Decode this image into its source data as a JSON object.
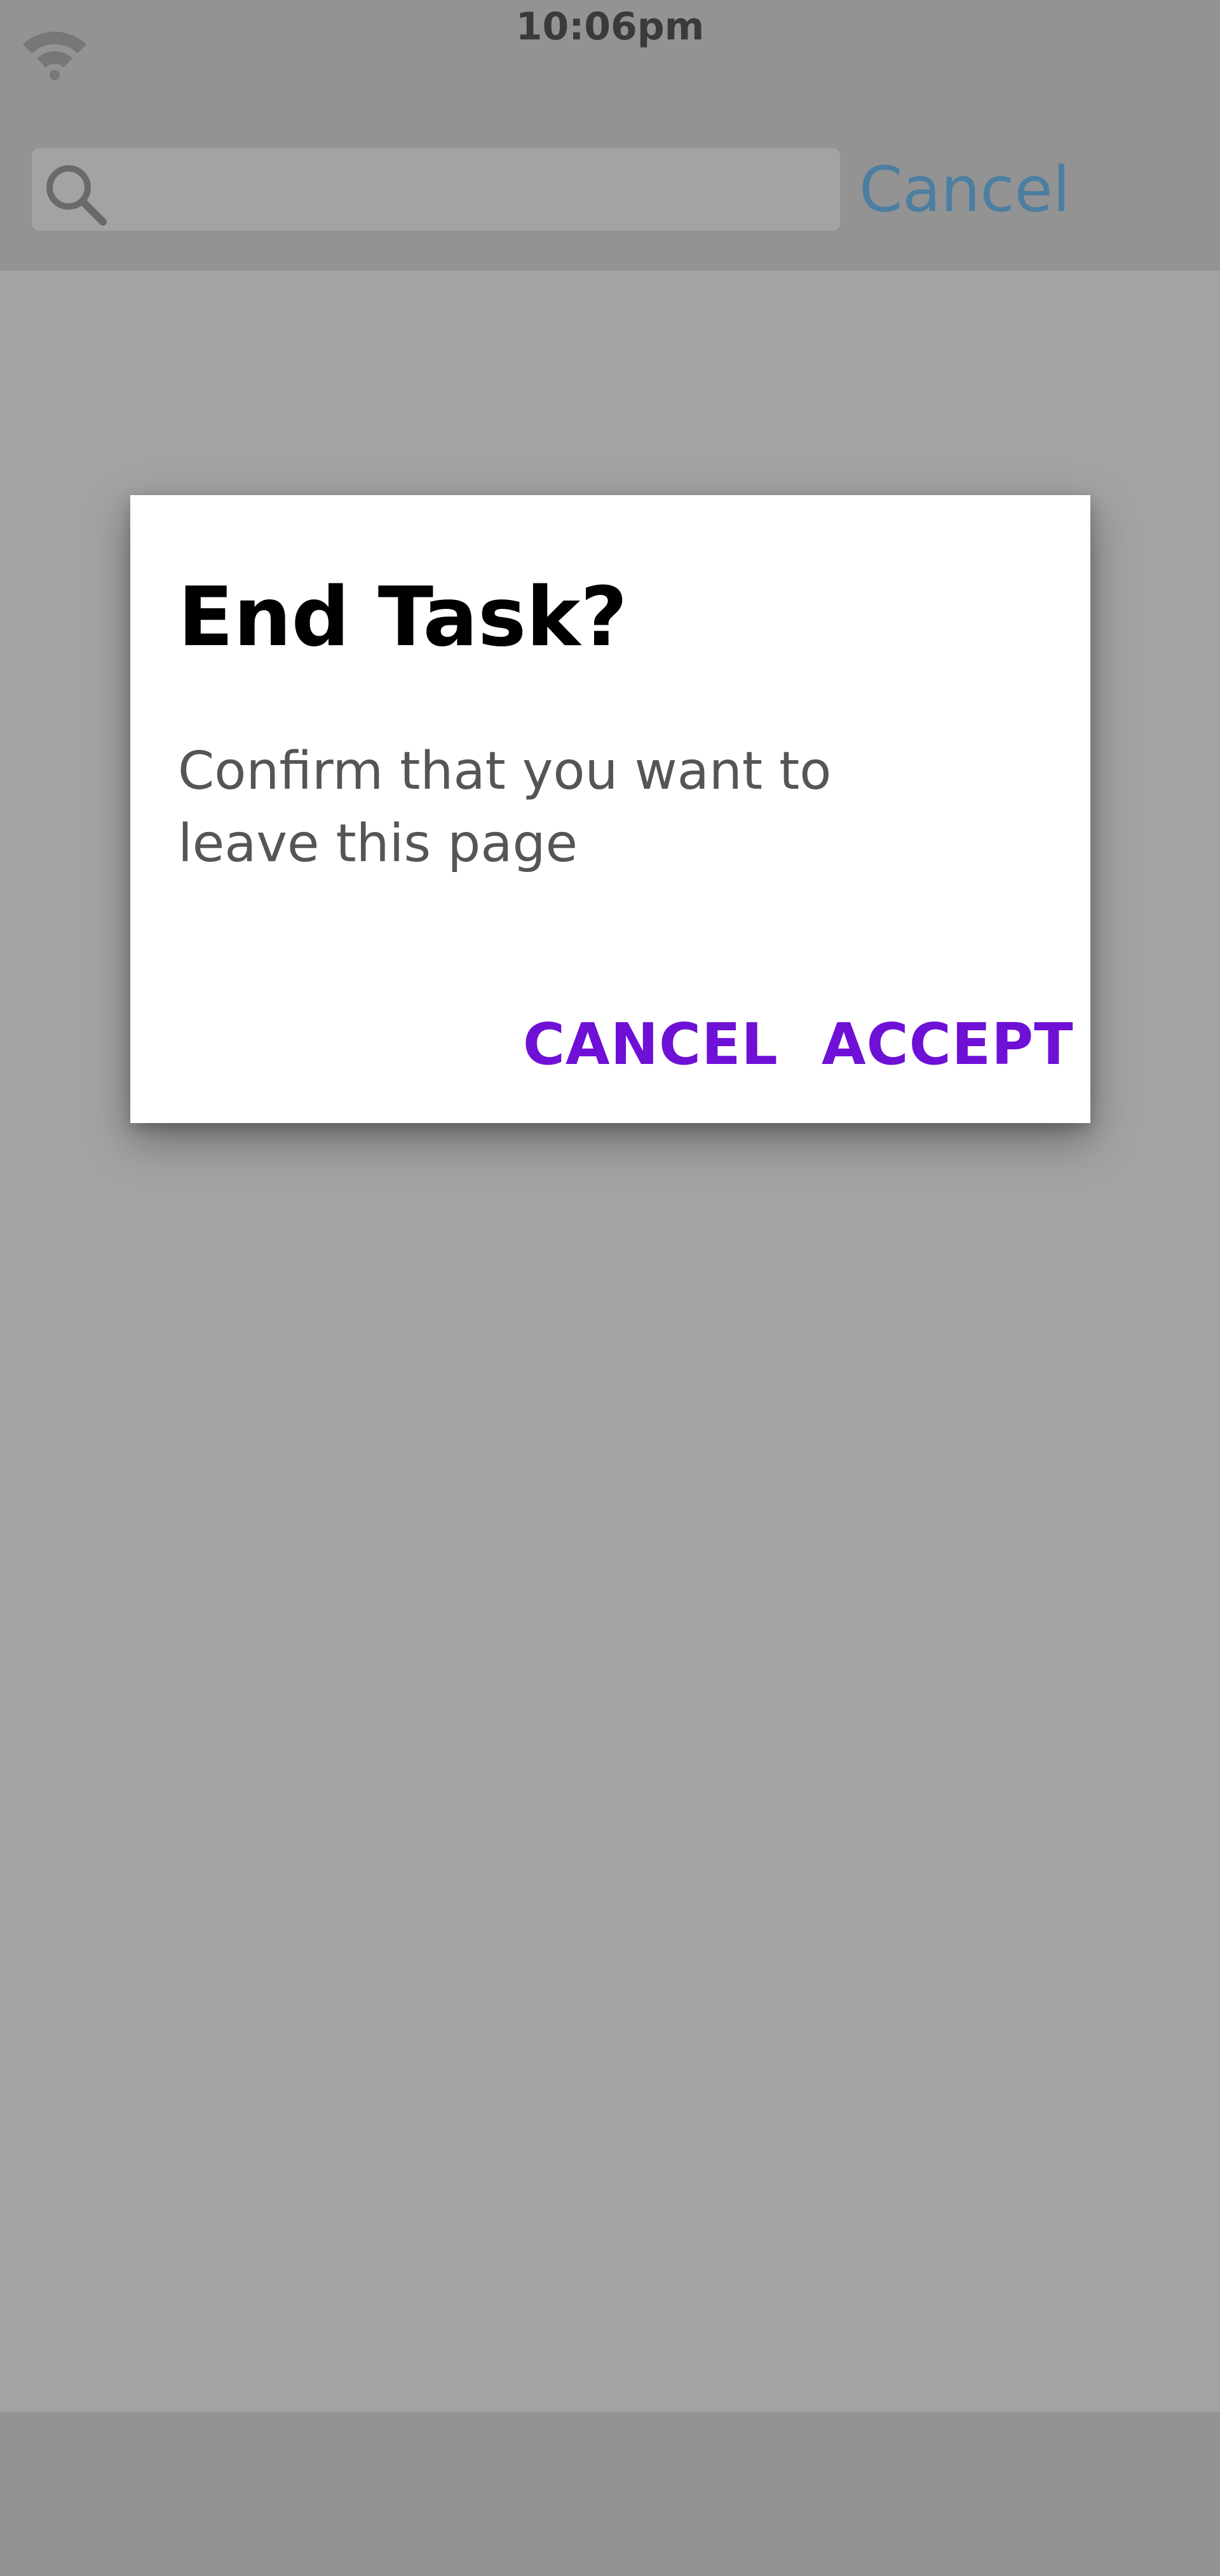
{
  "status_bar": {
    "time": "10:06pm",
    "wifi_icon": "wifi-icon"
  },
  "search": {
    "icon": "search-icon",
    "placeholder": "",
    "cancel_label": "Cancel"
  },
  "dialog": {
    "title": "End Task?",
    "message": "Confirm that you want to leave this page",
    "cancel_label": "CANCEL",
    "accept_label": "ACCEPT"
  },
  "colors": {
    "overlay_background": "#a3a3a3",
    "bar_background": "#939393",
    "accent": "#6e10d6",
    "link": "#4c7ea1"
  }
}
